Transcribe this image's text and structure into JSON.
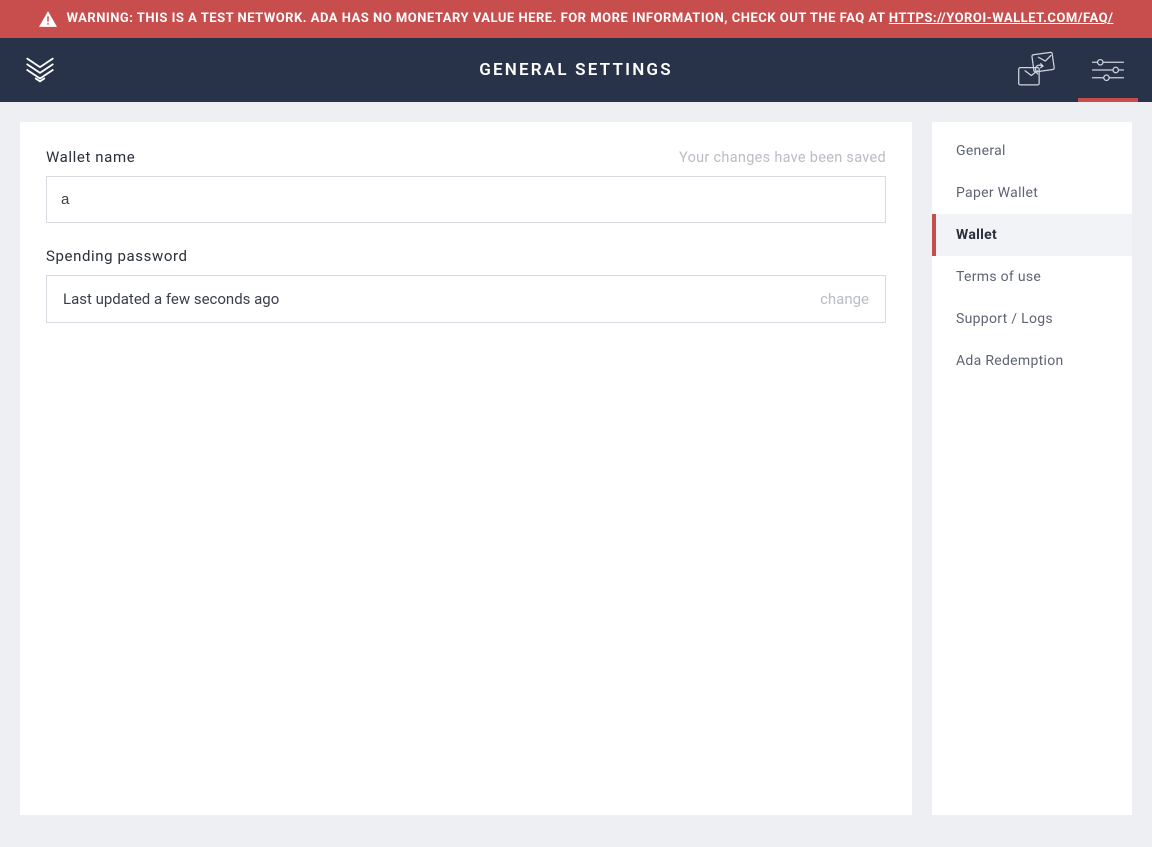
{
  "banner": {
    "text_prefix": "WARNING: THIS IS A TEST NETWORK. ADA HAS NO MONETARY VALUE HERE. FOR MORE INFORMATION, CHECK OUT THE FAQ AT ",
    "link_text": "HTTPS://YOROI-WALLET.COM/FAQ/"
  },
  "header": {
    "title": "GENERAL SETTINGS"
  },
  "main": {
    "wallet_name_label": "Wallet name",
    "save_message": "Your changes have been saved",
    "wallet_name_value": "a",
    "spending_password_label": "Spending password",
    "spending_password_text": "Last updated a few seconds ago",
    "change_label": "change"
  },
  "sidebar": {
    "items": [
      {
        "label": "General",
        "active": false
      },
      {
        "label": "Paper Wallet",
        "active": false
      },
      {
        "label": "Wallet",
        "active": true
      },
      {
        "label": "Terms of use",
        "active": false
      },
      {
        "label": "Support / Logs",
        "active": false
      },
      {
        "label": "Ada Redemption",
        "active": false
      }
    ]
  }
}
